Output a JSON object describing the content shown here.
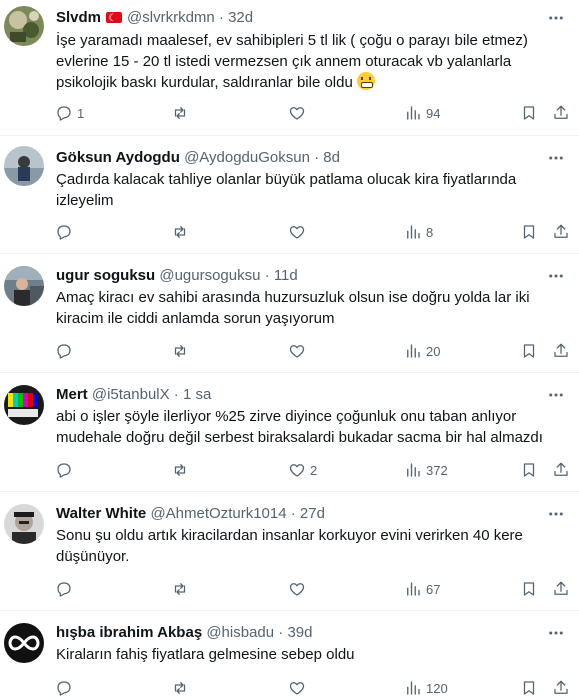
{
  "tweets": [
    {
      "name": "Slvdm",
      "has_flag": true,
      "handle": "@slvrkrkdmn",
      "time": "32d",
      "text": "İşe yaramadı maalesef, ev sahibipleri 5 tl lik ( çoğu o parayı bile etmez) evlerine 15 - 20 tl istedi vermezsen çık annem oturacak vb yalanlarla psikolojik baskı kurdular, saldıranlar bile oldu",
      "emoji": "grimacing-face",
      "replies": "1",
      "retweets": "",
      "likes": "",
      "views": "94"
    },
    {
      "name": "Göksun Aydogdu",
      "handle": "@AydogduGoksun",
      "time": "8d",
      "text": "Çadırda kalacak tahliye olanlar büyük patlama olucak kira fiyatlarında izleyelim",
      "replies": "",
      "retweets": "",
      "likes": "",
      "views": "8"
    },
    {
      "name": "ugur soguksu",
      "handle": "@ugursoguksu",
      "time": "11d",
      "text": "Amaç kiracı ev sahibi arasında huzursuzluk olsun ise doğru yolda lar iki kiracim ile ciddi anlamda sorun yaşıyorum",
      "replies": "",
      "retweets": "",
      "likes": "",
      "views": "20"
    },
    {
      "name": "Mert",
      "handle": "@i5tanbulX",
      "time": "1 sa",
      "text": "abi o işler şöyle ilerliyor %25 zirve diyince çoğunluk onu taban anlıyor mudehale doğru değil serbest biraksalardi bukadar sacma bir hal almazdı",
      "replies": "",
      "retweets": "",
      "likes": "2",
      "views": "372"
    },
    {
      "name": "Walter White",
      "handle": "@AhmetOzturk1014",
      "time": "27d",
      "text": "Sonu şu oldu artık kiracilardan insanlar korkuyor evini verirken 40 kere düşünüyor.",
      "replies": "",
      "retweets": "",
      "likes": "",
      "views": "67"
    },
    {
      "name": "hışba ibrahim Akbaş",
      "handle": "@hisbadu",
      "time": "39d",
      "text": "Kiraların fahiş fiyatlara gelmesine sebep oldu",
      "replies": "",
      "retweets": "",
      "likes": "",
      "views": "120"
    }
  ],
  "separator": "·",
  "colors": {
    "text": "#0f1419",
    "secondary": "#536471",
    "border": "#eff3f4",
    "flag": "#e30a17"
  },
  "icons": {
    "reply": "reply-icon",
    "retweet": "retweet-icon",
    "like": "heart-icon",
    "views": "views-chart-icon",
    "bookmark": "bookmark-icon",
    "share": "share-icon",
    "more": "more-dots-icon"
  }
}
